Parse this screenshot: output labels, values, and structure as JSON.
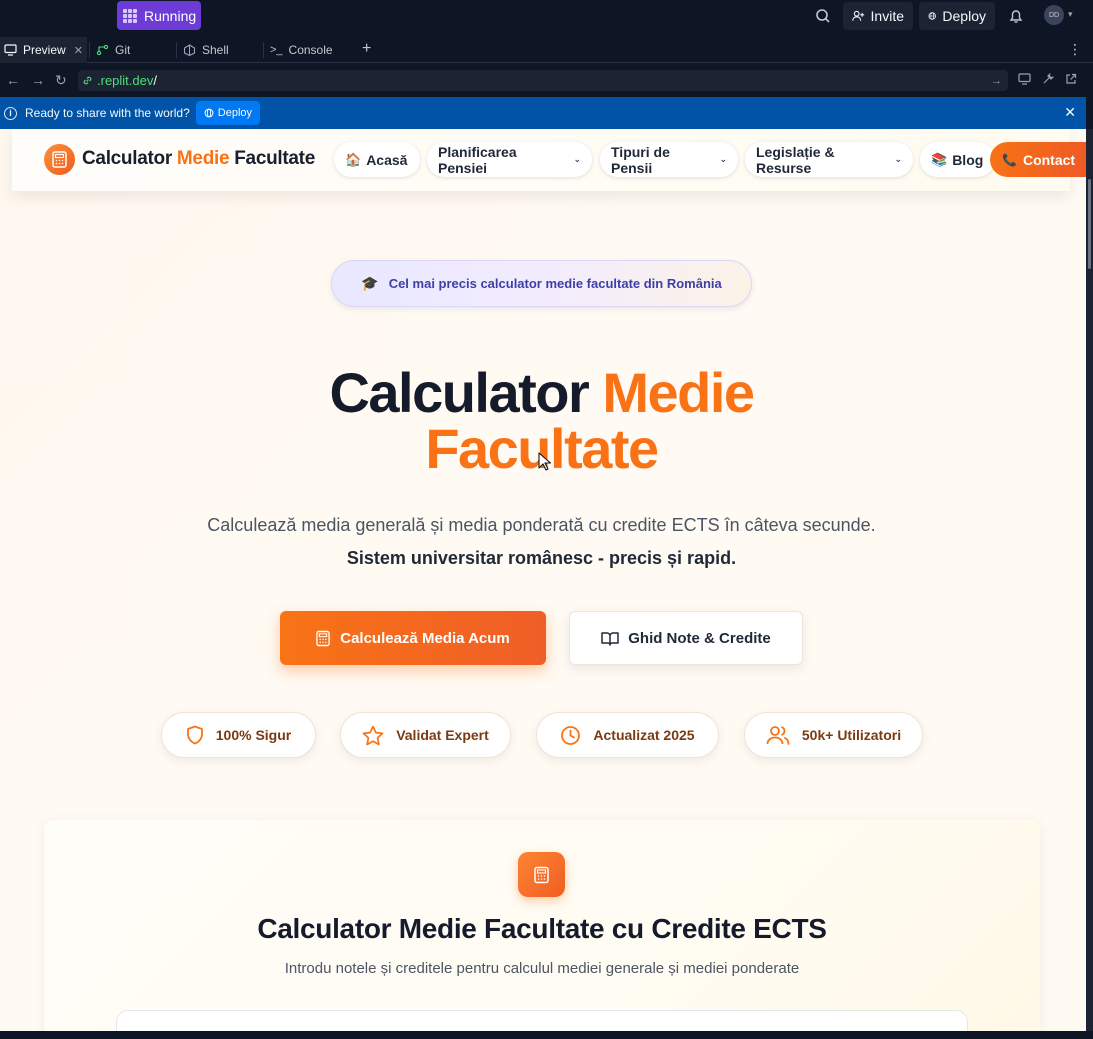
{
  "ide": {
    "status_label": "Running",
    "invite_label": "Invite",
    "deploy_label": "Deploy",
    "avatar_initials": "DD",
    "tabs": [
      {
        "label": "Preview",
        "active": true
      },
      {
        "label": "Git"
      },
      {
        "label": "Shell"
      },
      {
        "label": "Console"
      }
    ],
    "url": {
      "domain": ".replit.dev",
      "path": "/"
    },
    "banner": {
      "text": "Ready to share with the world?",
      "deploy_label": "Deploy"
    }
  },
  "site": {
    "logo": {
      "part1": "Calculator ",
      "part2": "Medie",
      "part3": " Facultate"
    },
    "nav": {
      "home": "Acasă",
      "pension_planning": "Planificarea Pensiei",
      "pension_types": "Tipuri de Pensii",
      "legislation": "Legislație & Resurse",
      "blog": "Blog",
      "contact": "Contact"
    },
    "badge": "Cel mai precis calculator medie facultate din România",
    "hero": {
      "title_part1": "Calculator ",
      "title_part2": "Medie",
      "title_part3": "Facultate",
      "subtitle": "Calculează media generală și media ponderată cu credite ECTS în câteva secunde.",
      "subtitle_bold": "Sistem universitar românesc - precis și rapid.",
      "primary_button": "Calculează Media Acum",
      "secondary_button": "Ghid Note & Credite"
    },
    "features": [
      "100% Sigur",
      "Validat Expert",
      "Actualizat 2025",
      "50k+ Utilizatori"
    ],
    "calculator": {
      "title": "Calculator Medie Facultate cu Credite ECTS",
      "subtitle": "Introdu notele și creditele pentru calculul mediei generale și mediei ponderate"
    },
    "colors": {
      "accent": "#f97316",
      "dark": "#161b2c",
      "badge_text": "#3c3fa6"
    }
  }
}
